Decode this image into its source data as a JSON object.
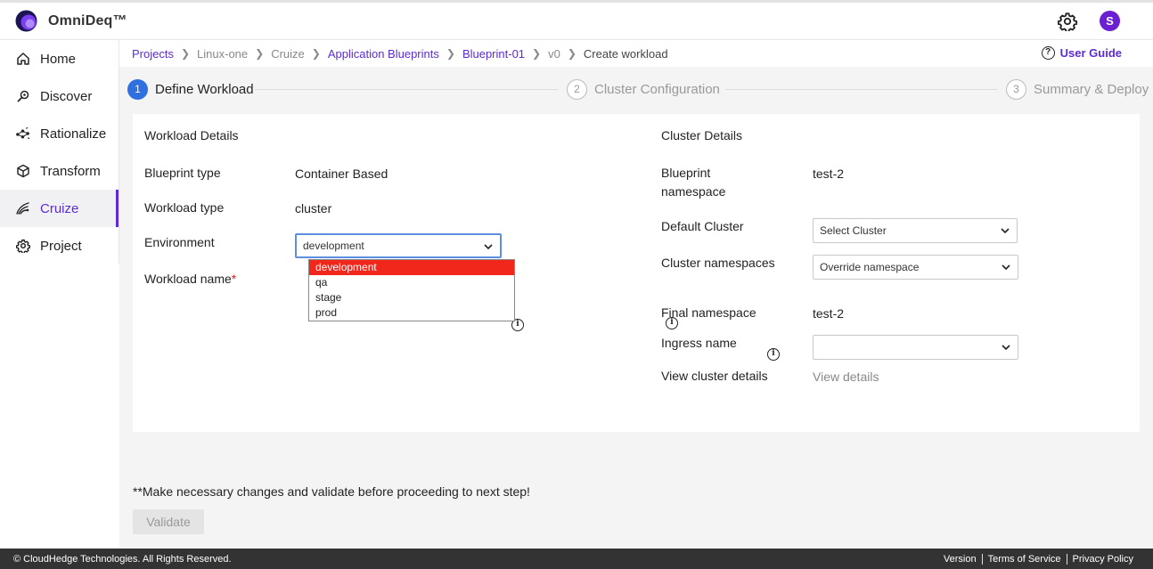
{
  "app": {
    "brand": "OmniDeq™",
    "avatar_initial": "S"
  },
  "colors": {
    "accent": "#5b2bd6",
    "step_active": "#2f6fe0",
    "dropdown_selected": "#f2271c",
    "footer_bg": "#333333"
  },
  "sidebar": {
    "items": [
      {
        "label": "Home",
        "icon": "home-icon"
      },
      {
        "label": "Discover",
        "icon": "discover-icon"
      },
      {
        "label": "Rationalize",
        "icon": "rationalize-icon"
      },
      {
        "label": "Transform",
        "icon": "cube-icon"
      },
      {
        "label": "Cruize",
        "icon": "cruize-icon",
        "active": true
      },
      {
        "label": "Project",
        "icon": "gear-icon"
      }
    ]
  },
  "breadcrumb": {
    "items": [
      "Projects",
      "Linux-one",
      "Cruize",
      "Application Blueprints",
      "Blueprint-01",
      "v0",
      "Create workload"
    ],
    "user_guide": "User Guide"
  },
  "steps": [
    {
      "num": "1",
      "label": "Define Workload",
      "active": true
    },
    {
      "num": "2",
      "label": "Cluster Configuration",
      "active": false
    },
    {
      "num": "3",
      "label": "Summary & Deploy",
      "active": false
    }
  ],
  "workload": {
    "title": "Workload Details",
    "blueprint_type_label": "Blueprint type",
    "blueprint_type_value": "Container Based",
    "workload_type_label": "Workload type",
    "workload_type_value": "cluster",
    "environment_label": "Environment",
    "environment_value": "development",
    "environment_options": [
      "development",
      "qa",
      "stage",
      "prod"
    ],
    "workload_name_label": "Workload name",
    "required_mark": "*"
  },
  "cluster": {
    "title": "Cluster Details",
    "blueprint_ns_label_1": "Blueprint",
    "blueprint_ns_label_2": "namespace",
    "blueprint_ns_value": "test-2",
    "default_cluster_label": "Default Cluster",
    "default_cluster_value": "Select Cluster",
    "cluster_ns_label": "Cluster namespaces",
    "cluster_ns_value": "Override namespace",
    "final_ns_label": "Final namespace",
    "final_ns_value": "test-2",
    "ingress_label": "Ingress name",
    "ingress_value": "",
    "view_label": "View cluster details",
    "view_link": "View details"
  },
  "note": "**Make necessary changes and validate before proceeding to next step!",
  "validate_label": "Validate",
  "footer": {
    "copyright": "© CloudHedge Technologies. All Rights Reserved.",
    "links": [
      "Version",
      "Terms of Service",
      "Privacy Policy"
    ]
  }
}
